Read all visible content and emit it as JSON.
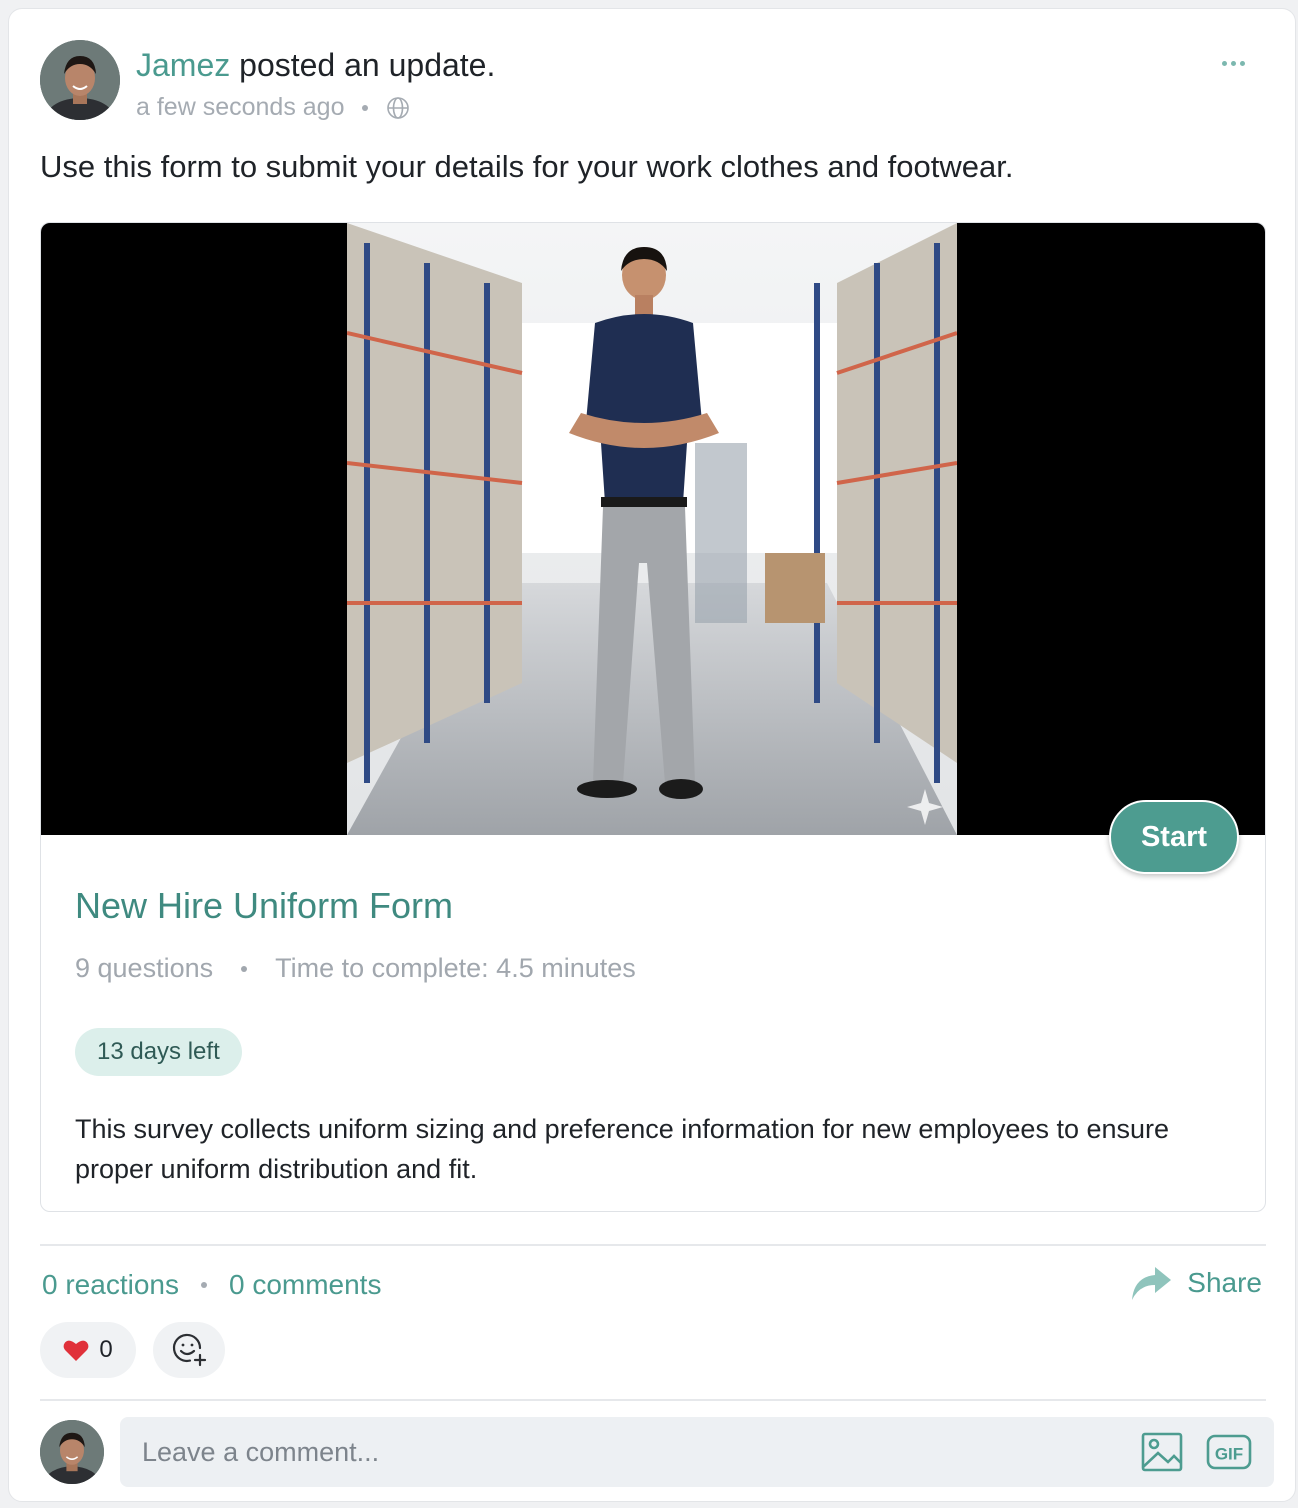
{
  "post": {
    "author": "Jamez",
    "action": " posted an update.",
    "timestamp": "a few seconds ago",
    "visibility_icon": "globe-icon",
    "more_icon": "more-options-icon",
    "text": "Use this form to submit your details for your work clothes and footwear."
  },
  "form": {
    "start_label": "Start",
    "title": "New Hire Uniform Form",
    "questions": "9 questions",
    "time": "Time to complete: 4.5 minutes",
    "badge": "13 days left",
    "description": "This survey collects uniform sizing and preference information for new employees to ensure proper uniform distribution and fit."
  },
  "stats": {
    "reactions": "0 reactions",
    "comments": "0 comments",
    "share": "Share"
  },
  "reactions": {
    "heart_count": "0"
  },
  "comment": {
    "placeholder": "Leave a comment..."
  },
  "colors": {
    "accent": "#4d9c90",
    "link": "#4a9a8f",
    "badge_bg": "#dcefeb"
  }
}
